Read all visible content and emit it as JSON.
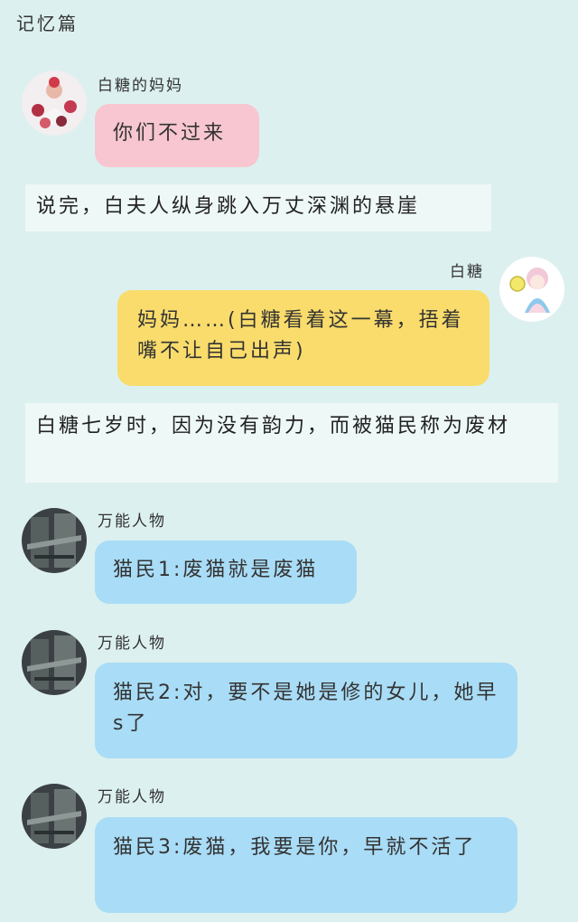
{
  "header": {
    "title": "记忆篇"
  },
  "messages": [
    {
      "sender": "白糖的妈妈",
      "text": "你们不过来",
      "avatar": "mother-avatar"
    },
    {
      "narration": "说完，白夫人纵身跳入万丈深渊的悬崖"
    },
    {
      "sender": "白糖",
      "text": "妈妈……(白糖看着这一幕，捂着嘴不让自己出声)",
      "avatar": "baitang-avatar"
    },
    {
      "narration": "白糖七岁时，因为没有韵力，而被猫民称为废材"
    },
    {
      "sender": "万能人物",
      "text": "猫民1:废猫就是废猫",
      "avatar": "universal-character-avatar"
    },
    {
      "sender": "万能人物",
      "text": "猫民2:对，要不是她是修的女儿，她早s了",
      "avatar": "universal-character-avatar"
    },
    {
      "sender": "万能人物",
      "text": "猫民3:废猫，我要是你，早就不活了",
      "avatar": "universal-character-avatar"
    }
  ],
  "colors": {
    "background": "#dcf0ef",
    "narration_bg": "#eef8f7",
    "pink_bubble": "#f7c6d0",
    "yellow_bubble": "#f9dc6c",
    "blue_bubble": "#a9dcf6"
  }
}
